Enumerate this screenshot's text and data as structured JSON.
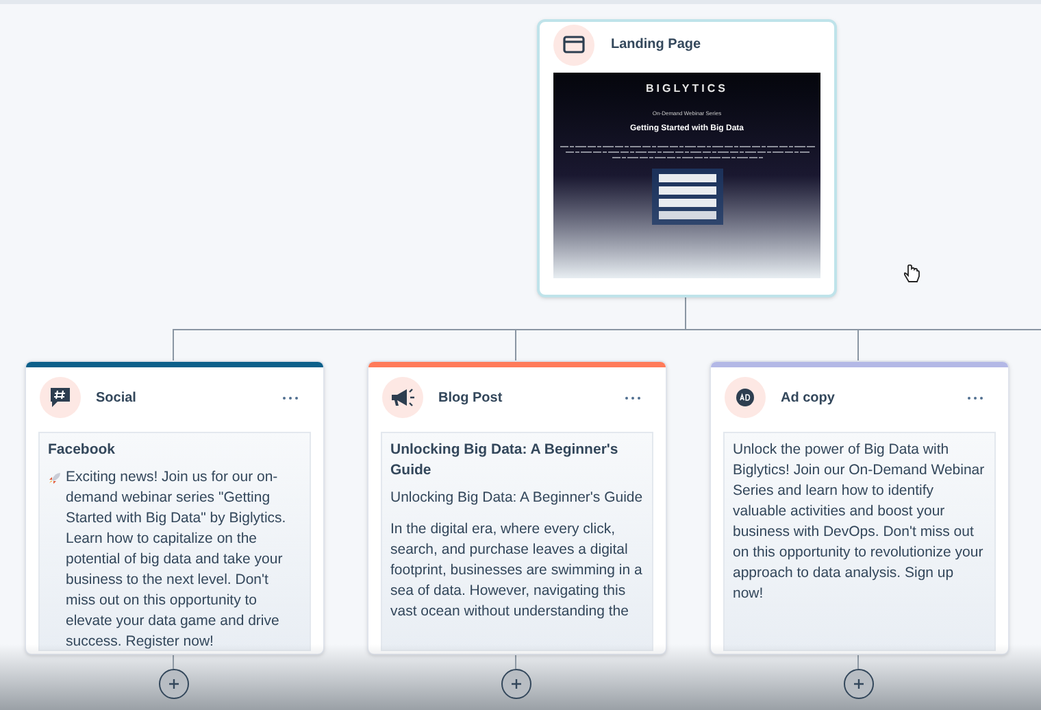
{
  "landing_page": {
    "title": "Landing Page",
    "preview": {
      "logo": "BIGLYTICS",
      "eyebrow": "On-Demand Webinar Series",
      "headline": "Getting Started with Big Data"
    }
  },
  "cards": [
    {
      "kind": "social",
      "title": "Social",
      "color": "#0b5f8a",
      "heading": "Facebook",
      "paragraphs": [
        "Exciting news! Join us for our on-demand webinar series \"Getting Started with Big Data\" by Biglytics. Learn how to capitalize on the potential of big data and take your business to the next level. Don't miss out on this opportunity to elevate your data game and drive success. Register now!"
      ]
    },
    {
      "kind": "blog",
      "title": "Blog Post",
      "color": "#ff7a59",
      "heading": "Unlocking Big Data: A Beginner's Guide",
      "paragraphs": [
        "Unlocking Big Data: A Beginner's Guide",
        "In the digital era, where every click, search, and purchase leaves a digital footprint, businesses are swimming in a sea of data. However, navigating this vast ocean without understanding the"
      ]
    },
    {
      "kind": "ad",
      "title": "Ad copy",
      "color": "#b3b8e6",
      "paragraphs": [
        "Unlock the power of Big Data with Biglytics! Join our On-Demand Webinar Series and learn how to identify valuable activities and boost your business with DevOps. Don't miss out on this opportunity to revolutionize your approach to data analysis. Sign up now!"
      ]
    }
  ]
}
